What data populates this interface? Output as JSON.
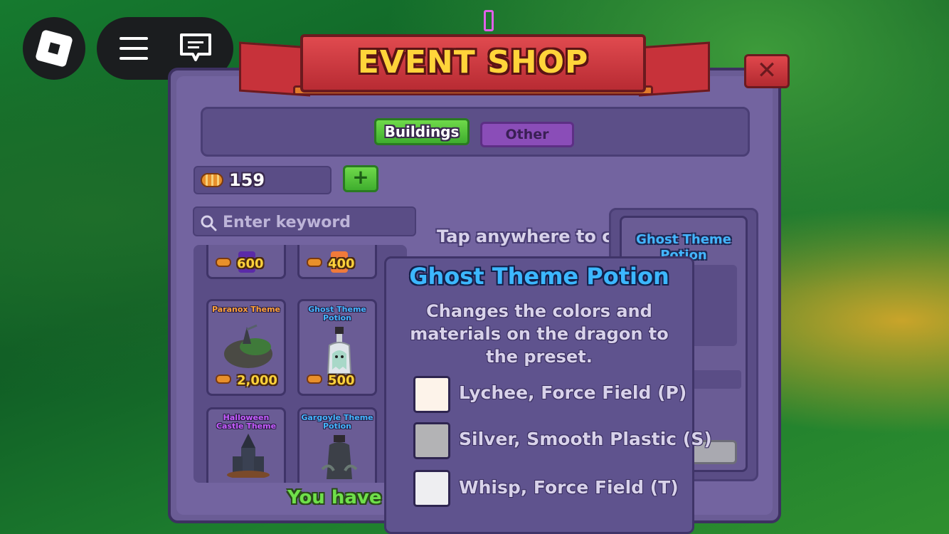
{
  "topbar": {
    "roblox_logo": "roblox-logo-icon",
    "menu_icon": "hamburger-menu-icon",
    "chat_icon": "chat-icon"
  },
  "shop": {
    "title": "EVENT SHOP",
    "close_label": "✕",
    "tabs": [
      {
        "label": "Buildings",
        "active": true
      },
      {
        "label": "Other",
        "active": false
      }
    ],
    "currency": {
      "icon": "candy-icon",
      "amount": "159"
    },
    "add_currency_label": "+",
    "search": {
      "placeholder": "Enter keyword",
      "value": ""
    },
    "tap_hint": "Tap anywhere to close",
    "items": [
      {
        "title": "",
        "price": "600"
      },
      {
        "title": "",
        "price": "400"
      },
      {
        "title": "Paranox Theme",
        "price": "2,000"
      },
      {
        "title": "Ghost Theme Potion",
        "price": "500"
      },
      {
        "title": "Halloween Castle Theme",
        "price": ""
      },
      {
        "title": "Gargoyle Theme Potion",
        "price": ""
      }
    ],
    "footer_text": "You have",
    "preview": {
      "title": "Ghost Theme Potion"
    }
  },
  "tooltip": {
    "title": "Ghost Theme Potion",
    "description": "Changes the colors and materials on the dragon to the preset.",
    "colors": [
      {
        "label": "Lychee, Force Field (P)",
        "hex": "#fdf3ea"
      },
      {
        "label": "Silver, Smooth Plastic (S)",
        "hex": "#b3b3b5"
      },
      {
        "label": "Whisp, Force Field (T)",
        "hex": "#eeeef1"
      }
    ]
  },
  "colors": {
    "panel": "#7364a0",
    "tab_active": "#4fc23a",
    "tab_inactive": "#8a4db8",
    "banner": "#c7323a",
    "title_gold": "#ffd43a",
    "price": "#ffd23a",
    "tooltip_title": "#3cb7ff"
  }
}
